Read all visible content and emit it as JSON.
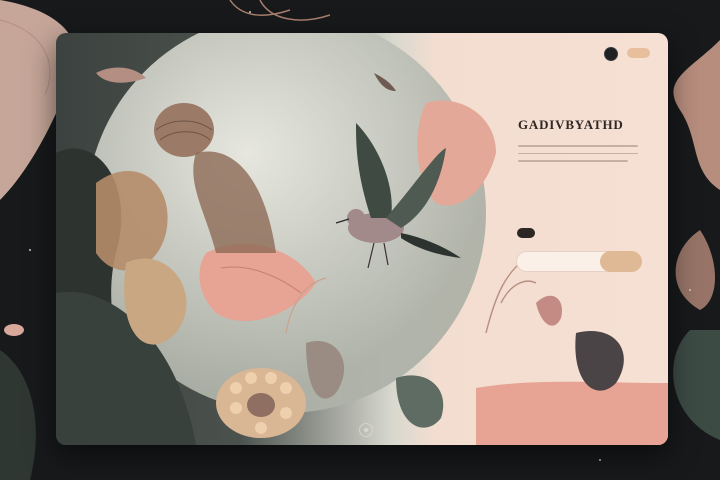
{
  "nav": {
    "left": [
      "",
      "",
      ""
    ],
    "right": [
      "",
      "",
      "",
      "",
      ""
    ]
  },
  "hero": {
    "eyebrow_small": "",
    "eyebrow": "",
    "title": "GADIVBYATHD",
    "subtitle": ""
  },
  "subscribe": {
    "placeholder": "",
    "button_label": ""
  },
  "colors": {
    "page_bg": "#17191b",
    "card_panel": "#f6e0d3",
    "accent_pink": "#e7a393",
    "accent_gold": "#dfb996",
    "dark_green": "#3c423f"
  },
  "icons": {
    "account": "dark-circle-icon",
    "carousel": "carousel-indicator-icon"
  }
}
